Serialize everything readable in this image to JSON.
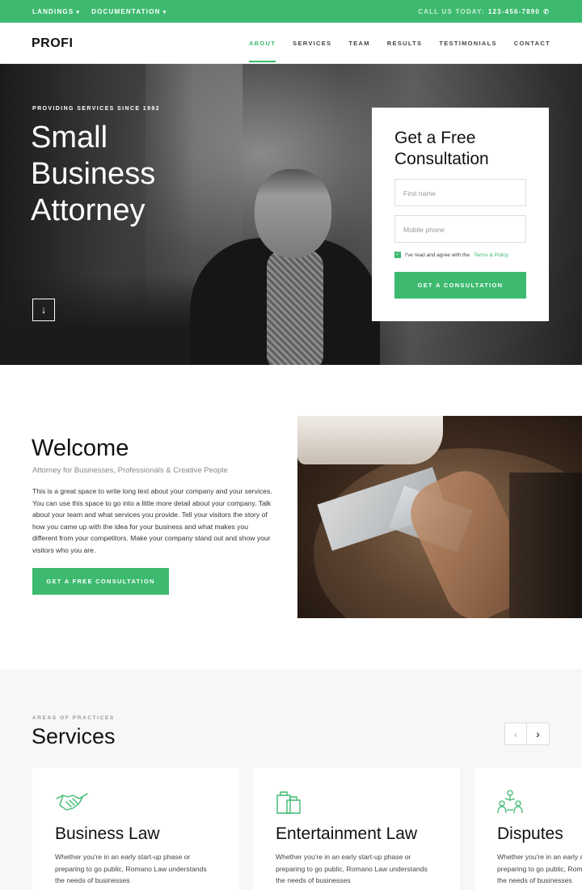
{
  "topbar": {
    "links": [
      "LANDINGS",
      "DOCUMENTATION"
    ],
    "call_label": "CALL US TODAY:",
    "phone": "123-456-7890"
  },
  "header": {
    "logo": "PROFI",
    "nav": [
      "ABOUT",
      "SERVICES",
      "TEAM",
      "RESULTS",
      "TESTIMONIALS",
      "CONTACT"
    ],
    "active_nav": "ABOUT"
  },
  "hero": {
    "kicker": "PROVIDING SERVICES SINCE 1992",
    "title": "Small Business Attorney"
  },
  "form": {
    "title": "Get a Free Consultation",
    "first_name_placeholder": "First name",
    "phone_placeholder": "Mobile phone",
    "agree_text": "I've read and agree with the",
    "agree_link": "Terms & Policy",
    "checked": true,
    "button": "GET A CONSULTATION"
  },
  "welcome": {
    "title": "Welcome",
    "subtitle": "Attorney for Businesses, Professionals & Creative People",
    "body": "This is a great space to write long text about your company and your services. You can use this space to go into a little more detail about your company. Talk about your team and what services you provide. Tell your visitors the story of how you came up with the idea for your business and what makes you different from your competitors. Make your company stand out and show your visitors who you are.",
    "button": "GET A FREE CONSULTATION"
  },
  "services": {
    "kicker": "AREAS OF PRACTICES",
    "title": "Services",
    "cards": [
      {
        "icon": "handshake-icon",
        "title": "Business Law",
        "text": "Whether you're in an early start-up phase or preparing to go public, Romano Law understands the needs of businesses"
      },
      {
        "icon": "shopping-bags-icon",
        "title": "Entertainment Law",
        "text": "Whether you're in an early start-up phase or preparing to go public, Romano Law understands the needs of businesses"
      },
      {
        "icon": "people-dispute-icon",
        "title": "Disputes",
        "text": "Whether you're in an early start-up phase or preparing to go public, Romano Law understands the needs of businesses"
      }
    ]
  },
  "colors": {
    "accent": "#3dba6f"
  }
}
